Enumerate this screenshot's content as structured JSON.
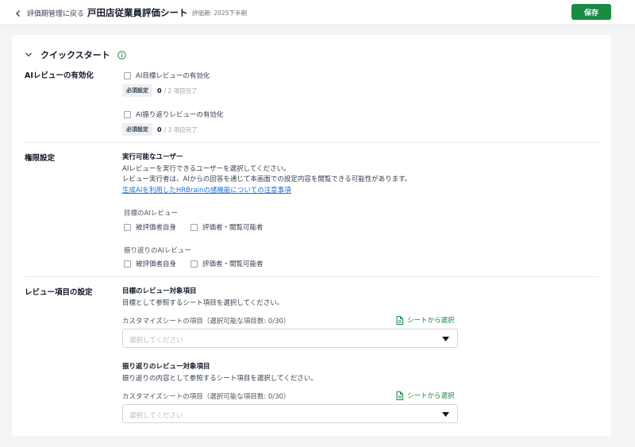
{
  "header": {
    "back_label": "評価期管理に戻る",
    "sheet_title": "戸田店従業員評価シート",
    "period": "評価期: 2025下半期",
    "save_label": "保存"
  },
  "quickstart": {
    "title": "クイックスタート"
  },
  "ai_review": {
    "label": "AIレビューの有効化",
    "goal_checkbox": "AI目標レビューの有効化",
    "goal_badge": "必須設定",
    "goal_done": "0",
    "goal_rest": "/ 2 項目完了",
    "reflection_checkbox": "AI振り返りレビューの有効化",
    "reflection_badge": "必須設定",
    "reflection_done": "0",
    "reflection_rest": "/ 3 項目完了"
  },
  "permissions": {
    "label": "権限設定",
    "subtitle": "実行可能なユーザー",
    "desc1": "AIレビューを実行できるユーザーを選択してください。",
    "desc2": "レビュー実行者は、AIからの回答を通じて本画面での設定内容を閲覧できる可能性があります。",
    "link": "生成AIを利用したHRBrainの諸機能についての注意事項",
    "goal_label": "目標のAIレビュー",
    "goal_opt1": "被評価者自身",
    "goal_opt2": "評価者・閲覧可能者",
    "refl_label": "振り返りのAIレビュー",
    "refl_opt1": "被評価者自身",
    "refl_opt2": "評価者・閲覧可能者"
  },
  "review_items": {
    "label": "レビュー項目の設定",
    "goal_title": "目標のレビュー対象項目",
    "goal_desc": "目標として参照するシート項目を選択してください。",
    "goal_field_label": "カスタマイズシートの項目（選択可能な項目数: 0/30）",
    "goal_link": "シートから選択",
    "goal_placeholder": "選択してください",
    "refl_title": "振り返りのレビュー対象項目",
    "refl_desc": "振り返りの内容として参照するシート項目を選択してください。",
    "refl_field_label": "カスタマイズシートの項目（選択可能な項目数: 0/30）",
    "refl_link": "シートから選択",
    "refl_placeholder": "選択してください"
  },
  "colors": {
    "primary_green": "#1a8a44",
    "link_blue": "#1d6fd6",
    "background": "#f3f4f6"
  },
  "icons": [
    "chevron-left-icon",
    "chevron-down-icon",
    "info-icon",
    "document-icon",
    "caret-down-icon"
  ]
}
